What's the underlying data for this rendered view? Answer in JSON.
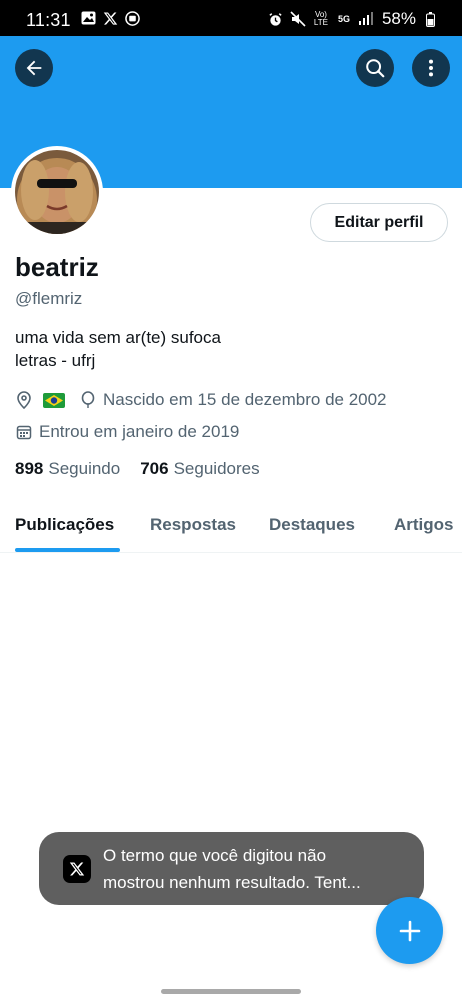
{
  "status_bar": {
    "time": "11:31",
    "battery": "58%",
    "left_icons": [
      "gallery-icon",
      "x-icon",
      "media-icon"
    ],
    "right_icons": [
      "alarm-icon",
      "mute-icon",
      "volte-icon",
      "5g-icon",
      "signal-icon",
      "battery-icon"
    ],
    "volte_label": "Vo) LTE",
    "network_label": "5G"
  },
  "header": {
    "banner_color": "#1d9bf0",
    "back_icon": "arrow-left-icon",
    "search_icon": "search-icon",
    "more_icon": "more-vertical-icon"
  },
  "profile": {
    "edit_button": "Editar perfil",
    "name": "beatriz",
    "handle": "@flemriz",
    "bio_lines": [
      "uma vida sem ar(te) sufoca",
      "letras - ufrj"
    ],
    "location_flag": "brazil-flag",
    "birth": "Nascido em 15 de dezembro de 2002",
    "joined": "Entrou em janeiro de 2019",
    "following_count": "898",
    "following_label": "Seguindo",
    "followers_count": "706",
    "followers_label": "Seguidores"
  },
  "tabs": [
    {
      "label": "Publicações",
      "active": true
    },
    {
      "label": "Respostas",
      "active": false
    },
    {
      "label": "Destaques",
      "active": false
    },
    {
      "label": "Artigos",
      "active": false
    }
  ],
  "toast": {
    "text": "O termo que você digitou não\nmostrou nenhum resultado. Tent..."
  },
  "fab": {
    "icon": "plus-icon"
  },
  "colors": {
    "accent": "#1d9bf0",
    "text": "#0f1419",
    "secondary": "#536471"
  }
}
